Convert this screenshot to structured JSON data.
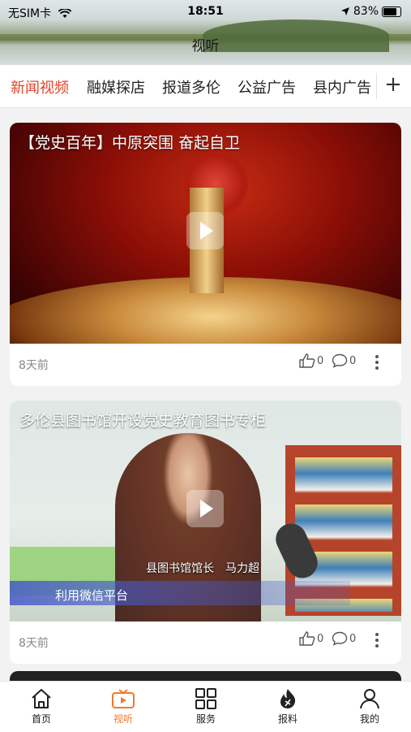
{
  "status_bar": {
    "carrier": "无SIM卡",
    "time": "18:51",
    "battery": "83%"
  },
  "page_title": "视听",
  "tabs": [
    {
      "label": "新闻视频",
      "active": true
    },
    {
      "label": "融媒探店",
      "active": false
    },
    {
      "label": "报道多伦",
      "active": false
    },
    {
      "label": "公益广告",
      "active": false
    },
    {
      "label": "县内广告",
      "active": false
    }
  ],
  "add_tab_label": "+",
  "videos": [
    {
      "title": "【党史百年】中原突围 奋起自卫",
      "time": "8天前",
      "likes": "0",
      "comments": "0"
    },
    {
      "title": "多伦县图书馆开设党史教育图书专柜",
      "caption_name": "县图书馆馆长　马力超",
      "subtitle": "利用微信平台",
      "time": "8天前",
      "likes": "0",
      "comments": "0"
    }
  ],
  "tabbar": [
    {
      "label": "首页",
      "icon": "home-icon",
      "active": false
    },
    {
      "label": "视听",
      "icon": "tv-icon",
      "active": true
    },
    {
      "label": "服务",
      "icon": "grid-icon",
      "active": false
    },
    {
      "label": "报料",
      "icon": "flame-icon",
      "active": false
    },
    {
      "label": "我的",
      "icon": "user-icon",
      "active": false
    }
  ],
  "colors": {
    "accent": "#e0442a",
    "tabbar_active": "#f07a2b"
  }
}
